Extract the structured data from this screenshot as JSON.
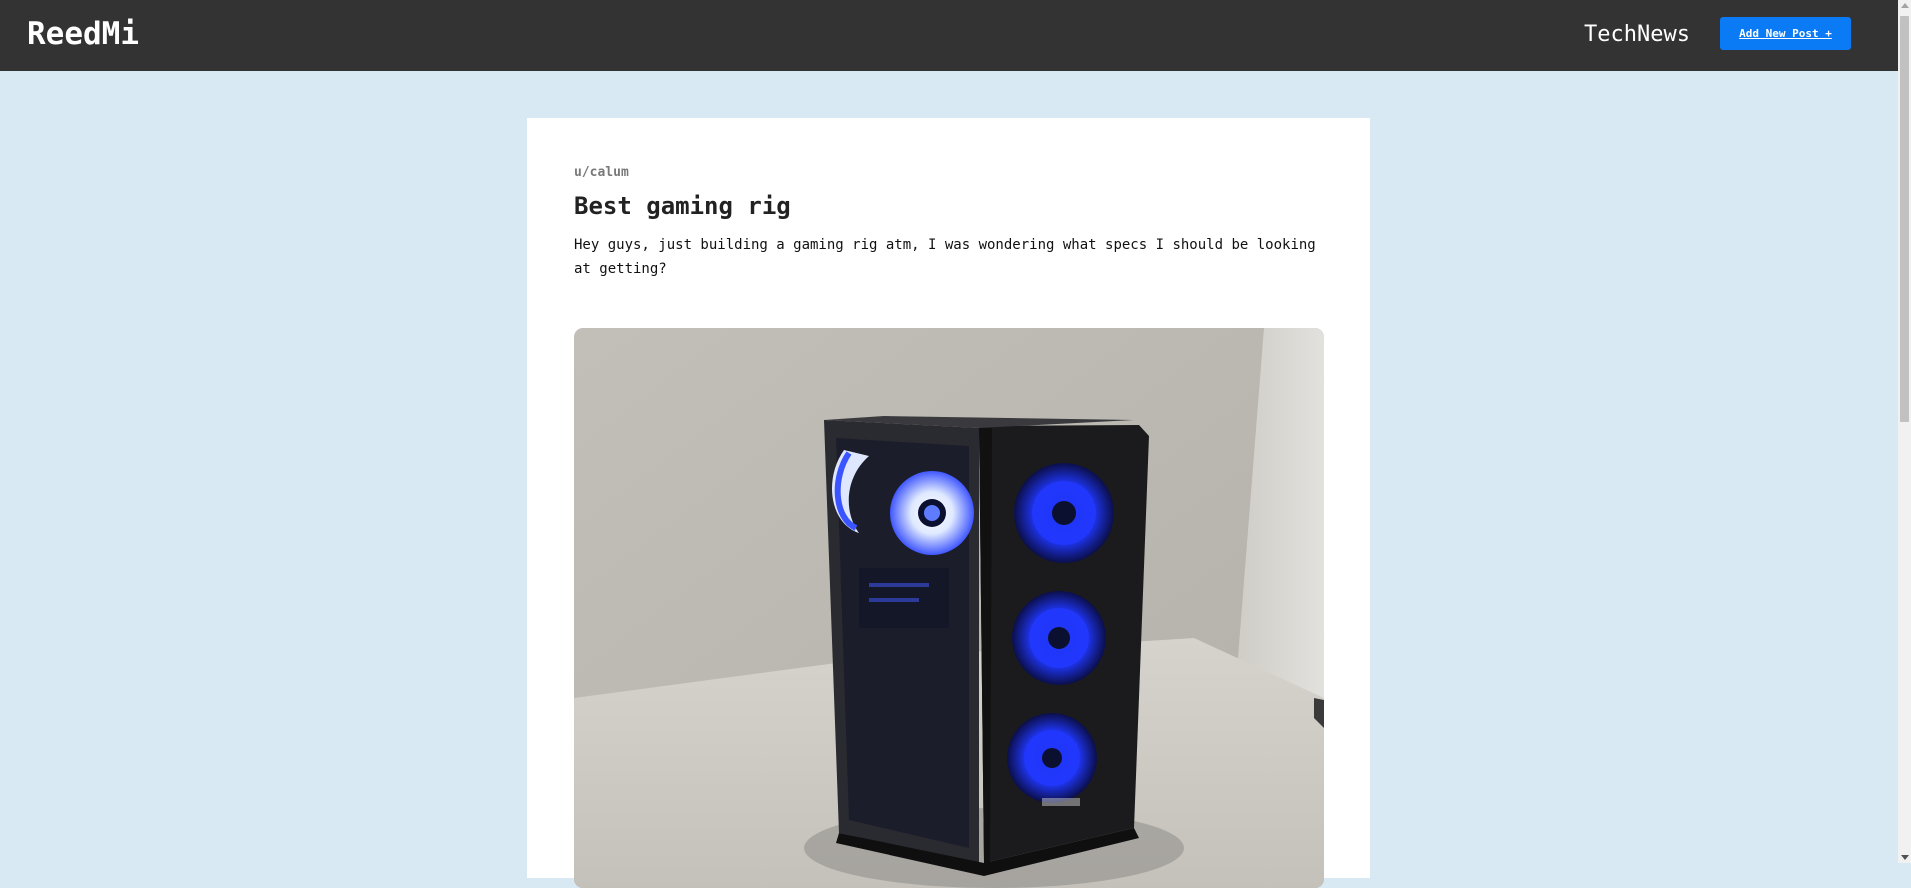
{
  "navbar": {
    "brand": "ReedMi",
    "community": "TechNews",
    "add_post_label": "Add New Post +"
  },
  "post": {
    "author": "u/calum",
    "title": "Best gaming rig",
    "body": "Hey guys, just building a gaming rig atm, I was wondering what specs I should be looking at getting?"
  },
  "colors": {
    "navbar_bg": "#333333",
    "page_bg": "#d9e9f3",
    "accent": "#0b7af5"
  }
}
